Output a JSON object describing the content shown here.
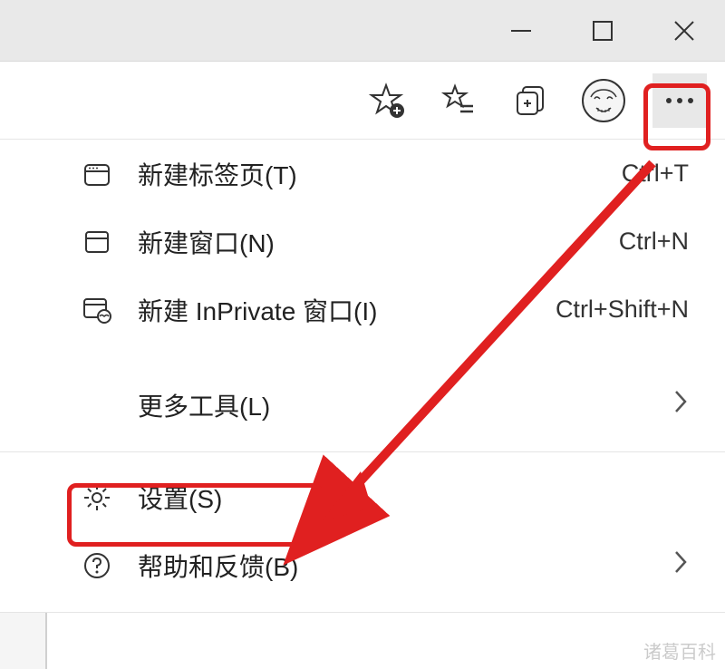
{
  "window": {
    "minimize": "minimize",
    "maximize": "maximize",
    "close": "close"
  },
  "toolbar": {
    "add_favorite": "add-favorite",
    "favorites": "favorites",
    "collections": "collections",
    "profile": "profile",
    "more": "more"
  },
  "menu": {
    "new_tab": {
      "label": "新建标签页(T)",
      "shortcut": "Ctrl+T"
    },
    "new_window": {
      "label": "新建窗口(N)",
      "shortcut": "Ctrl+N"
    },
    "new_inprivate": {
      "label": "新建 InPrivate 窗口(I)",
      "shortcut": "Ctrl+Shift+N"
    },
    "more_tools": {
      "label": "更多工具(L)"
    },
    "settings": {
      "label": "设置(S)"
    },
    "help": {
      "label": "帮助和反馈(B)"
    }
  },
  "watermark": "诸葛百科",
  "colors": {
    "highlight": "#e02020"
  }
}
